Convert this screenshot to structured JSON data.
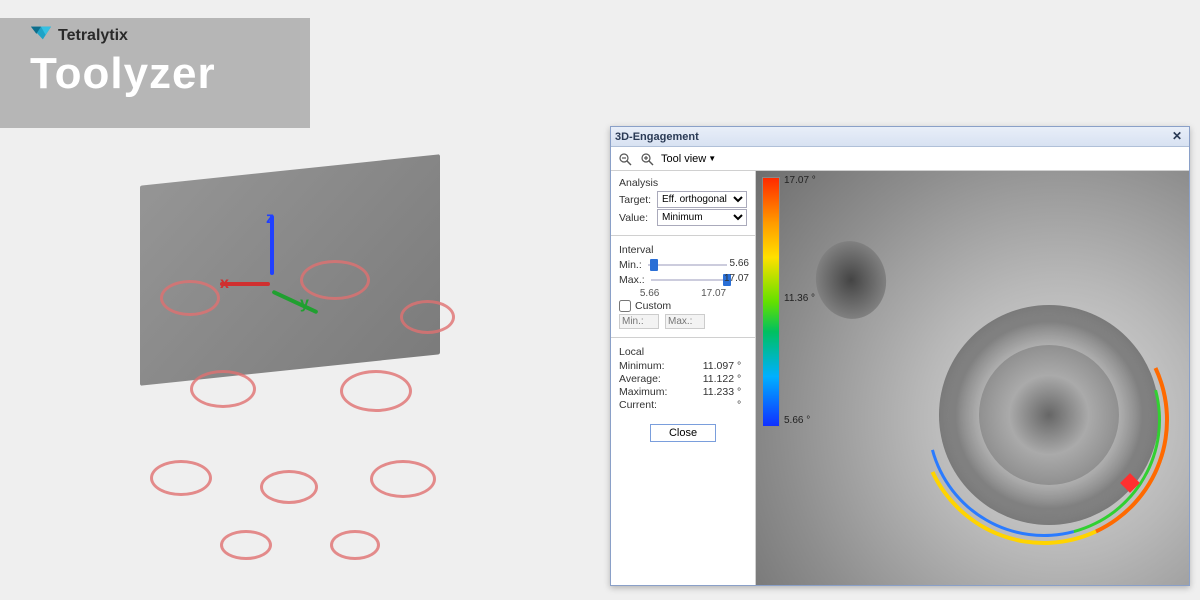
{
  "brand": {
    "company": "Tetralytix",
    "product": "Toolyzer"
  },
  "axes": {
    "x": "x",
    "y": "y",
    "z": "z"
  },
  "window": {
    "title": "3D-Engagement",
    "toolbar": {
      "view_label": "Tool view"
    },
    "analysis": {
      "section": "Analysis",
      "target_label": "Target:",
      "target_value": "Eff. orthogonal clearanc",
      "value_label": "Value:",
      "value_value": "Minimum"
    },
    "interval": {
      "section": "Interval",
      "min_label": "Min.:",
      "min_value": "5.66",
      "max_label": "Max.:",
      "max_value": "17.07",
      "lo": "5.66",
      "hi": "17.07",
      "custom_label": "Custom",
      "custom_min_ph": "Min.:",
      "custom_max_ph": "Max.:"
    },
    "local": {
      "section": "Local",
      "minimum_label": "Minimum:",
      "minimum_value": "11.097",
      "average_label": "Average:",
      "average_value": "11.122",
      "maximum_label": "Maximum:",
      "maximum_value": "11.233",
      "current_label": "Current:",
      "current_value": "",
      "unit": "°"
    },
    "close": "Close",
    "legend": {
      "top": "17.07 °",
      "mid": "11.36 °",
      "bot": "5.66 °"
    }
  }
}
